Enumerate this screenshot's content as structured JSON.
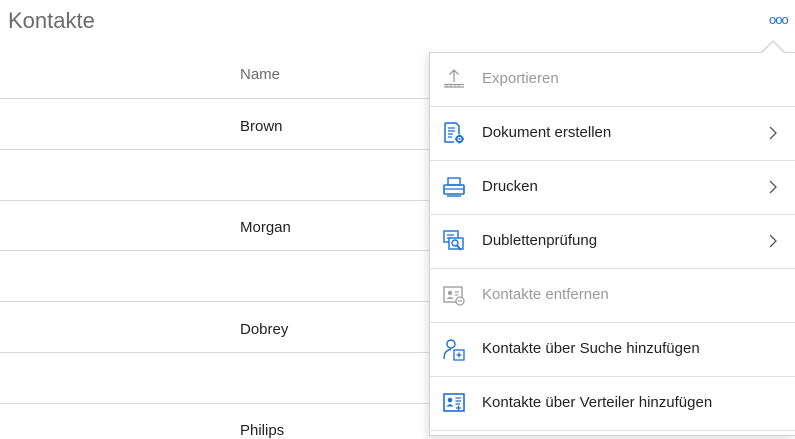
{
  "page": {
    "title": "Kontakte",
    "more_label": "ooo"
  },
  "table": {
    "column_header": "Name",
    "rows": [
      "Brown",
      "",
      "Morgan",
      "",
      "Dobrey",
      "",
      "Philips"
    ]
  },
  "menu": {
    "items": [
      {
        "label": "Exportieren",
        "icon": "export-icon",
        "enabled": false,
        "submenu": false
      },
      {
        "label": "Dokument erstellen",
        "icon": "document-settings-icon",
        "enabled": true,
        "submenu": true
      },
      {
        "label": "Drucken",
        "icon": "printer-icon",
        "enabled": true,
        "submenu": true
      },
      {
        "label": "Dublettenprüfung",
        "icon": "duplicate-check-icon",
        "enabled": true,
        "submenu": true
      },
      {
        "label": "Kontakte entfernen",
        "icon": "remove-contact-icon",
        "enabled": false,
        "submenu": false
      },
      {
        "label": "Kontakte über Suche hinzufügen",
        "icon": "add-contact-search-icon",
        "enabled": true,
        "submenu": false
      },
      {
        "label": "Kontakte über Verteiler hinzufügen",
        "icon": "add-contact-list-icon",
        "enabled": true,
        "submenu": false
      }
    ]
  },
  "colors": {
    "accent": "#1e6fd0",
    "disabled": "#9a9a9a",
    "divider": "#d9d9d9"
  }
}
